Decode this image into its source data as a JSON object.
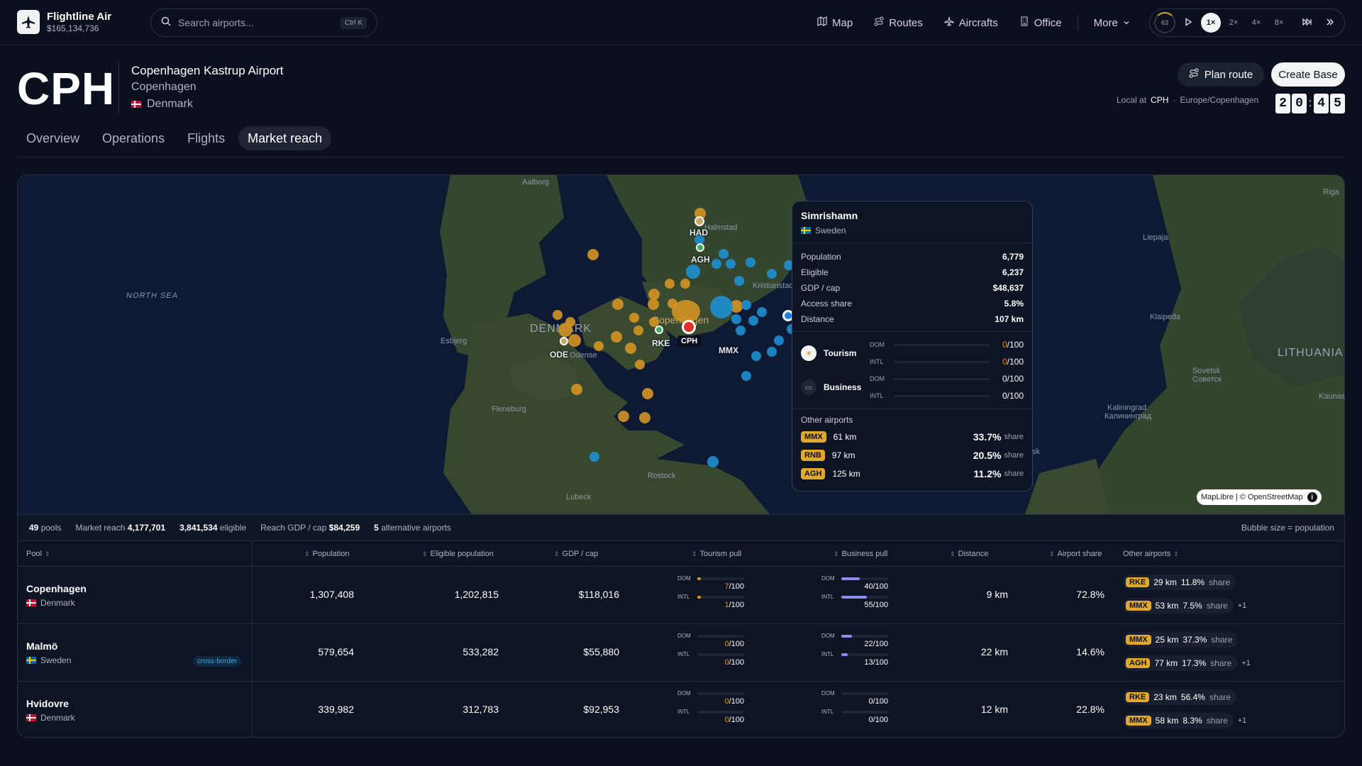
{
  "app": {
    "name": "Flightline Air",
    "balance": "$165,134,736"
  },
  "search": {
    "placeholder": "Search airports...",
    "shortcut": "Ctrl K"
  },
  "nav": {
    "map": "Map",
    "routes": "Routes",
    "aircrafts": "Aircrafts",
    "office": "Office",
    "more": "More"
  },
  "controls": {
    "progress": "63",
    "speeds": [
      "1×",
      "2×",
      "4×",
      "8×"
    ],
    "active_speed": "1×"
  },
  "airport": {
    "code": "CPH",
    "name": "Copenhagen Kastrup Airport",
    "city": "Copenhagen",
    "country": "Denmark"
  },
  "actions": {
    "plan_route": "Plan route",
    "create_base": "Create Base"
  },
  "localtime": {
    "prefix": "Local at",
    "code": "CPH",
    "tz": "Europe/Copenhagen",
    "digits": [
      "2",
      "0",
      "4",
      "5"
    ]
  },
  "tabs": [
    "Overview",
    "Operations",
    "Flights",
    "Market reach"
  ],
  "active_tab": "Market reach",
  "map": {
    "labels": {
      "aalborg": "Aalborg",
      "halmstad": "Halmstad",
      "north_sea": "NORTH SEA",
      "denmark": "DENMARK",
      "esbjerg": "Esbjerg",
      "odense": "Odense",
      "copenhagen": "Copenhagen",
      "flensburg": "Flensburg",
      "rostock": "Rostock",
      "lubeck": "Lubeck",
      "kristianstad": "Kristianstad",
      "riga": "Riga",
      "liepaja": "Liepaja",
      "klaipeda": "Klaipeda",
      "lithuania": "LITHUANIA",
      "sovetsk": "Sovetsk",
      "sovetsk_cy": "Советск",
      "kaliningrad": "Kaliningrad",
      "kaliningrad_cy": "Калининград",
      "kaunas": "Kaunas",
      "sk": "sk"
    },
    "airport_tags": {
      "had": "HAD",
      "agh": "AGH",
      "rke": "RKE",
      "cph": "CPH",
      "mmx": "MMX",
      "ode": "ODE"
    },
    "attribution": "MapLibre | © OpenStreetMap"
  },
  "popup": {
    "title": "Simrishamn",
    "country": "Sweden",
    "stats": [
      {
        "k": "Population",
        "v": "6,779"
      },
      {
        "k": "Eligible",
        "v": "6,237"
      },
      {
        "k": "GDP / cap",
        "v": "$48,637"
      },
      {
        "k": "Access share",
        "v": "5.8%"
      },
      {
        "k": "Distance",
        "v": "107 km"
      }
    ],
    "tourism": {
      "label": "Tourism",
      "dom_label": "DOM",
      "dom": "0",
      "intl_label": "INTL",
      "intl": "0",
      "max": "/100"
    },
    "business": {
      "label": "Business",
      "dom_label": "DOM",
      "dom": "0",
      "intl_label": "INTL",
      "intl": "0",
      "max": "/100"
    },
    "other_title": "Other airports",
    "other": [
      {
        "code": "MMX",
        "km": "61 km",
        "pct": "33.7%",
        "share": "share"
      },
      {
        "code": "RNB",
        "km": "97 km",
        "pct": "20.5%",
        "share": "share"
      },
      {
        "code": "AGH",
        "km": "125 km",
        "pct": "11.2%",
        "share": "share"
      }
    ]
  },
  "summary": {
    "pools": "49",
    "pools_label": "pools",
    "reach_label": "Market reach",
    "reach": "4,177,701",
    "eligible": "3,841,534",
    "eligible_label": "eligible",
    "gdp_label": "Reach GDP / cap",
    "gdp": "$84,259",
    "alt": "5",
    "alt_label": "alternative airports",
    "legend": "Bubble size = population"
  },
  "table": {
    "headers": [
      "Pool",
      "Population",
      "Eligible population",
      "GDP / cap",
      "Tourism pull",
      "Business pull",
      "Distance",
      "Airport share",
      "Other airports"
    ],
    "rows": [
      {
        "pool": "Copenhagen",
        "country": "Denmark",
        "badge": "",
        "population": "1,307,408",
        "eligible": "1,202,815",
        "gdp": "$118,016",
        "t_dom": "7",
        "t_intl": "1",
        "b_dom": "40",
        "b_intl": "55",
        "distance": "9 km",
        "share": "72.8%",
        "others": [
          {
            "code": "RKE",
            "km": "29 km",
            "pct": "11.8%",
            "share": "share"
          },
          {
            "code": "MMX",
            "km": "53 km",
            "pct": "7.5%",
            "share": "share"
          }
        ],
        "more": "+1"
      },
      {
        "pool": "Malmö",
        "country": "Sweden",
        "badge": "cross-border",
        "population": "579,654",
        "eligible": "533,282",
        "gdp": "$55,880",
        "t_dom": "0",
        "t_intl": "0",
        "b_dom": "22",
        "b_intl": "13",
        "distance": "22 km",
        "share": "14.6%",
        "others": [
          {
            "code": "MMX",
            "km": "25 km",
            "pct": "37.3%",
            "share": "share"
          },
          {
            "code": "AGH",
            "km": "77 km",
            "pct": "17.3%",
            "share": "share"
          }
        ],
        "more": "+1"
      },
      {
        "pool": "Hvidovre",
        "country": "Denmark",
        "badge": "",
        "population": "339,982",
        "eligible": "312,783",
        "gdp": "$92,953",
        "t_dom": "0",
        "t_intl": "0",
        "b_dom": "0",
        "b_intl": "0",
        "distance": "12 km",
        "share": "22.8%",
        "others": [
          {
            "code": "RKE",
            "km": "23 km",
            "pct": "56.4%",
            "share": "share"
          },
          {
            "code": "MMX",
            "km": "58 km",
            "pct": "8.3%",
            "share": "share"
          }
        ],
        "more": "+1"
      }
    ],
    "dom_label": "DOM",
    "intl_label": "INTL",
    "max": "/100"
  },
  "colors": {
    "tourism": "#d49425",
    "business": "#8b8cf0",
    "accent": "#e2a82a"
  }
}
